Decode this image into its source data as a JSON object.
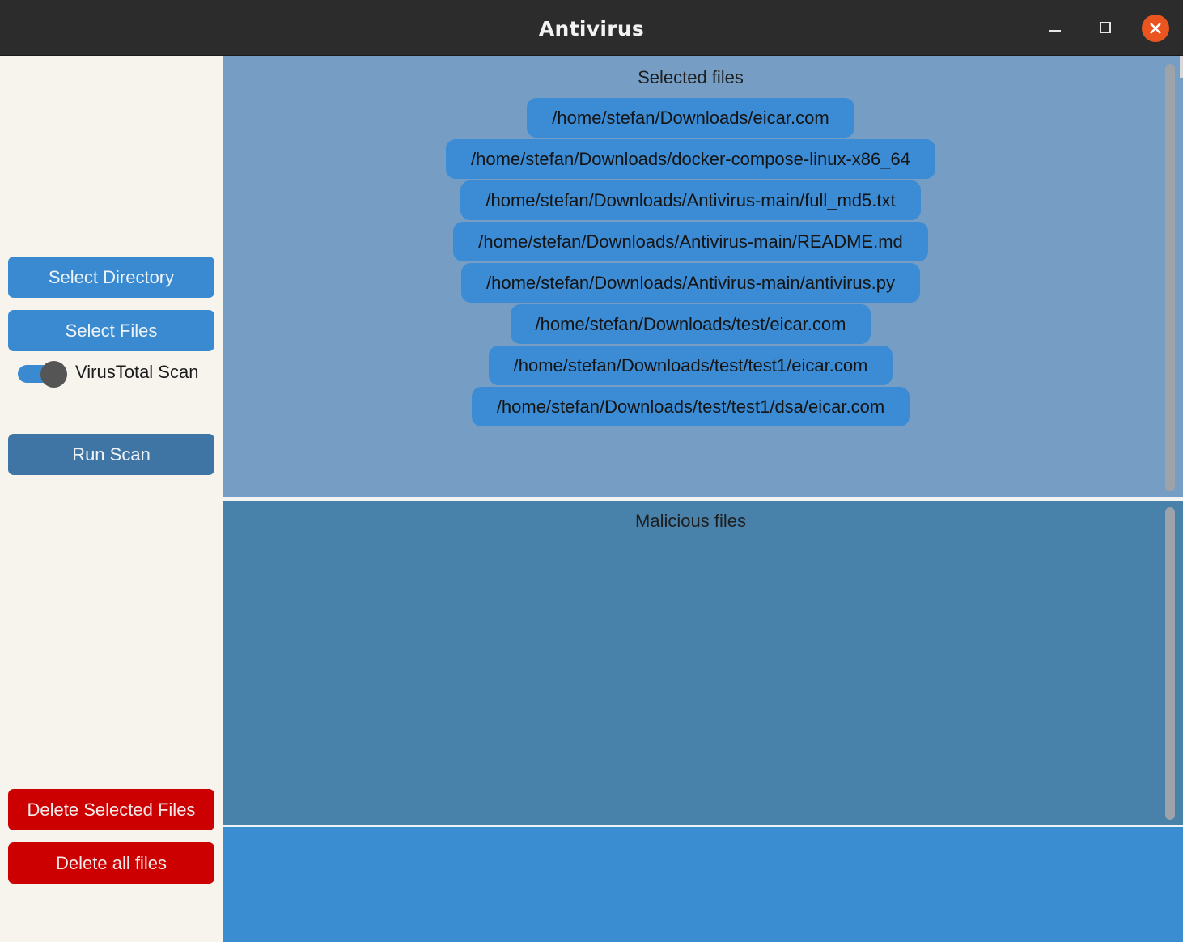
{
  "window": {
    "title": "Antivirus",
    "controls": [
      "minimize",
      "maximize",
      "close"
    ]
  },
  "sidebar": {
    "select_directory": "Select Directory",
    "select_files": "Select Files",
    "virustotal_toggle": {
      "label": "VirusTotal Scan",
      "on": true
    },
    "run_scan": "Run Scan",
    "delete_selected": "Delete Selected Files",
    "delete_all": "Delete all files"
  },
  "selected_panel": {
    "title": "Selected files",
    "files": [
      "/home/stefan/Downloads/eicar.com",
      "/home/stefan/Downloads/docker-compose-linux-x86_64",
      "/home/stefan/Downloads/Antivirus-main/full_md5.txt",
      "/home/stefan/Downloads/Antivirus-main/README.md",
      "/home/stefan/Downloads/Antivirus-main/antivirus.py",
      "/home/stefan/Downloads/test/eicar.com",
      "/home/stefan/Downloads/test/test1/eicar.com",
      "/home/stefan/Downloads/test/test1/dsa/eicar.com"
    ]
  },
  "malicious_panel": {
    "title": "Malicious files",
    "files": []
  },
  "colors": {
    "titlebar": "#2c2c2c",
    "sidebar": "#f7f4ed",
    "button_blue": "#3a8ad1",
    "button_run": "#3e75a4",
    "button_red": "#cc0000",
    "selected_panel": "#769ec4",
    "malicious_panel": "#4882ab",
    "bottom_panel": "#3b8dd2",
    "close_button": "#e9541f"
  }
}
